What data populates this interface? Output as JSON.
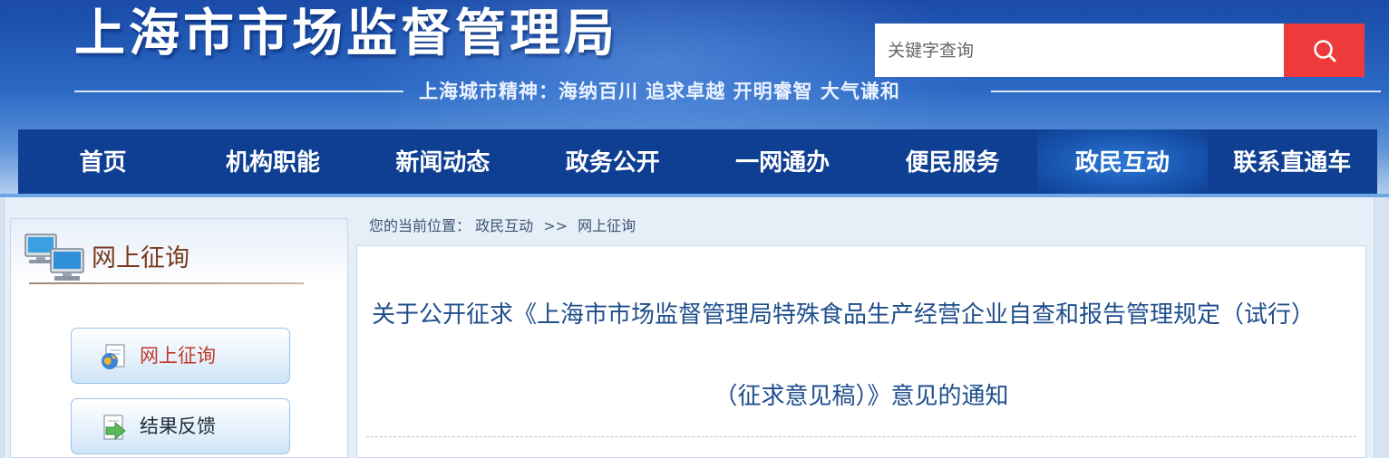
{
  "header": {
    "site_title": "上海市市场监督管理局",
    "slogan": "上海城市精神：海纳百川  追求卓越  开明睿智  大气谦和",
    "search": {
      "placeholder": "关键字查询",
      "icon": "search-icon"
    }
  },
  "nav": {
    "items": [
      {
        "label": "首页"
      },
      {
        "label": "机构职能"
      },
      {
        "label": "新闻动态"
      },
      {
        "label": "政务公开"
      },
      {
        "label": "一网通办"
      },
      {
        "label": "便民服务"
      },
      {
        "label": "政民互动",
        "active": true
      },
      {
        "label": "联系直通车"
      }
    ]
  },
  "sidebar": {
    "title": "网上征询",
    "header_icon": "computers-icon",
    "buttons": [
      {
        "label": "网上征询",
        "icon": "globe-document-icon",
        "active": true
      },
      {
        "label": "结果反馈",
        "icon": "arrow-document-icon"
      }
    ]
  },
  "breadcrumb": {
    "prefix": "您的当前位置：",
    "items": [
      "政民互动",
      "网上征询"
    ],
    "separator": ">>"
  },
  "article": {
    "title_line1": "关于公开征求《上海市市场监督管理局特殊食品生产经营企业自查和报告管理规定（试行）",
    "title_line2": "（征求意见稿）》意见的通知"
  },
  "colors": {
    "nav_bg": "#0f3f92",
    "search_button": "#ee3a3a",
    "title_blue": "#1f4e8c",
    "sidebar_title": "#7a3a1e",
    "active_button_text": "#c0392b"
  }
}
